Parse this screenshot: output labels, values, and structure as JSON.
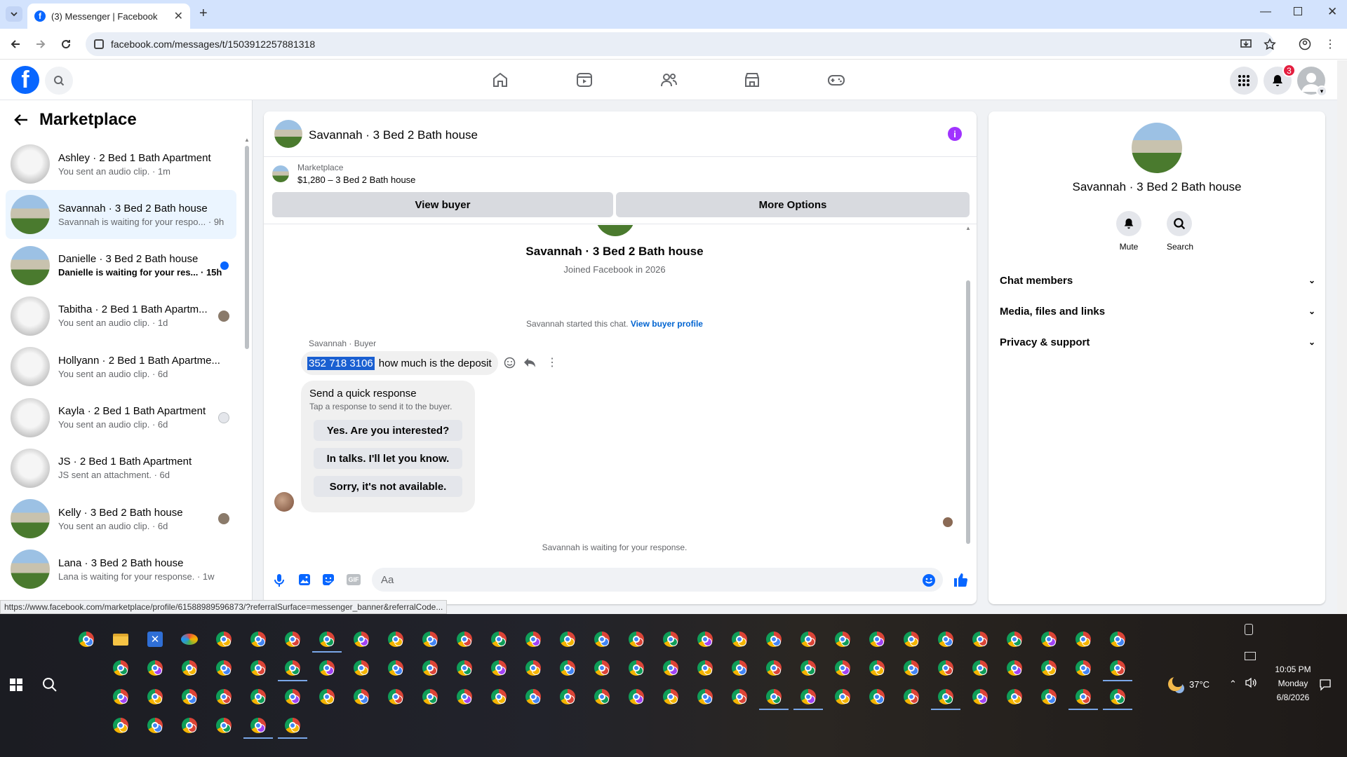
{
  "browser": {
    "tab_title": "(3) Messenger | Facebook",
    "url": "facebook.com/messages/t/1503912257881318",
    "status_url": "https://www.facebook.com/marketplace/profile/61588989596873/?referralSurface=messenger_banner&referralCode..."
  },
  "header": {
    "notification_count": "3",
    "nav_icons": [
      "home-icon",
      "video-icon",
      "friends-icon",
      "marketplace-icon",
      "gaming-icon"
    ]
  },
  "sidebar": {
    "title": "Marketplace",
    "conversations": [
      {
        "title": "Ashley · 2 Bed 1 Bath Apartment",
        "preview": "You sent an audio clip. · 1m",
        "thumb": "apt",
        "indicator": "none"
      },
      {
        "title": "Savannah · 3 Bed 2 Bath house",
        "preview": "Savannah is waiting for your respo... · 9h",
        "thumb": "house",
        "indicator": "none"
      },
      {
        "title": "Danielle · 3 Bed 2 Bath house",
        "preview": "Danielle is waiting for your res... · 15h",
        "thumb": "house",
        "indicator": "unread"
      },
      {
        "title": "Tabitha · 2 Bed 1 Bath Apartm...",
        "preview": "You sent an audio clip. · 1d",
        "thumb": "apt",
        "indicator": "seen"
      },
      {
        "title": "Hollyann · 2 Bed 1 Bath Apartme...",
        "preview": "You sent an audio clip. · 6d",
        "thumb": "apt",
        "indicator": "none"
      },
      {
        "title": "Kayla · 2 Bed 1 Bath Apartment",
        "preview": "You sent an audio clip. · 6d",
        "thumb": "apt",
        "indicator": "seen-grey"
      },
      {
        "title": "JS · 2 Bed 1 Bath Apartment",
        "preview": "JS sent an attachment. · 6d",
        "thumb": "apt",
        "indicator": "none"
      },
      {
        "title": "Kelly · 3 Bed 2 Bath house",
        "preview": "You sent an audio clip. · 6d",
        "thumb": "house",
        "indicator": "seen"
      },
      {
        "title": "Lana · 3 Bed 2 Bath house",
        "preview": "Lana is waiting for your response. · 1w",
        "thumb": "house",
        "indicator": "none"
      }
    ]
  },
  "chat": {
    "title": "Savannah · 3 Bed 2 Bath house",
    "listing_label": "Marketplace",
    "listing_price": "$1,280 – 3 Bed 2 Bath house",
    "view_buyer": "View buyer",
    "more_options": "More Options",
    "profile_name": "Savannah · 3 Bed 2 Bath house",
    "joined": "Joined Facebook in 2026",
    "started_text": "Savannah started this chat.",
    "view_profile_link": "View buyer profile",
    "sender_label": "Savannah · Buyer",
    "message_highlight": "352 718 3106",
    "message_rest": "how much is the deposit",
    "quick_title": "Send a quick response",
    "quick_sub": "Tap a response to send it to the buyer.",
    "quick_replies": [
      "Yes. Are you interested?",
      "In talks. I'll let you know.",
      "Sorry, it's not available."
    ],
    "waiting": "Savannah is waiting for your response.",
    "input_placeholder": "Aa"
  },
  "right_panel": {
    "name": "Savannah · 3 Bed 2 Bath house",
    "mute": "Mute",
    "search": "Search",
    "sections": [
      "Chat members",
      "Media, files and links",
      "Privacy & support"
    ]
  },
  "taskbar": {
    "weather": "37°C",
    "time": "10:05 PM",
    "day": "Monday",
    "date": "6/8/2026"
  },
  "colors": {
    "accent": "#0866ff",
    "fb_blue": "#0866ff",
    "badge_red": "#e41e3f",
    "info_purple": "#a033ff",
    "taskbar": "#1f2027"
  }
}
